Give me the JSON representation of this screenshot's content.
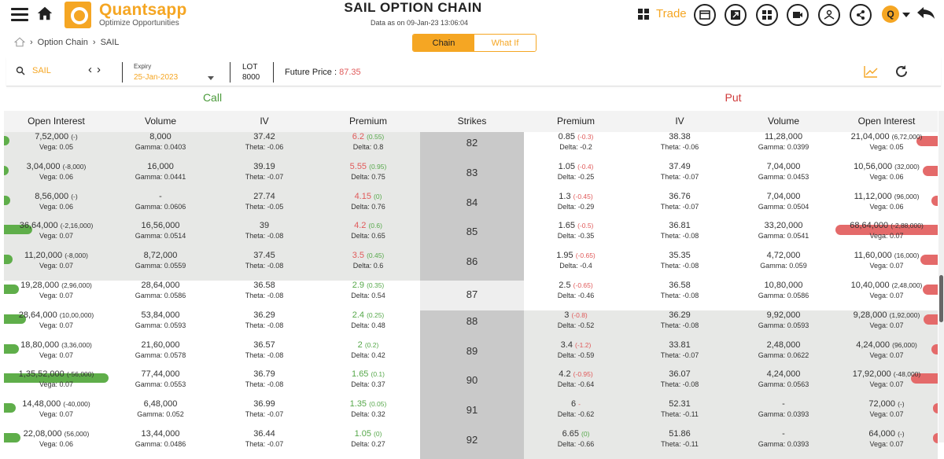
{
  "header": {
    "brand": "Quantsapp",
    "brand_tagline": "Optimize Opportunities",
    "title": "SAIL OPTION CHAIN",
    "as_of": "Data as on 09-Jan-23 13:06:04",
    "trade_label": "Trade",
    "avatar_initial": "Q"
  },
  "breadcrumb": {
    "item1": "Option Chain",
    "item2": "SAIL"
  },
  "tabs": {
    "chain": "Chain",
    "what_if": "What If",
    "active": "Chain"
  },
  "filters": {
    "symbol": "SAIL",
    "expiry_label": "Expiry",
    "expiry_value": "25-Jan-2023",
    "lot_label": "LOT",
    "lot_value": "8000",
    "future_label": "Future Price :",
    "future_value": "87.35"
  },
  "sections": {
    "call": "Call",
    "put": "Put"
  },
  "columns": [
    "Open Interest",
    "Volume",
    "IV",
    "Premium",
    "Strikes",
    "Premium",
    "IV",
    "Volume",
    "Open Interest"
  ],
  "colors": {
    "accent": "#f5a623",
    "call": "#4b9a3b",
    "put": "#cf3a3a",
    "call_bar": "#5fae4a",
    "put_bar": "#e46a6a"
  },
  "rows": [
    {
      "strike": "82",
      "c_oi": "7,52,000",
      "c_oi_chg": "(-)",
      "c_vega": "Vega: 0.05",
      "c_vol": "8,000",
      "c_gamma": "Gamma: 0.0403",
      "c_iv": "37.42",
      "c_theta": "Theta: -0.06",
      "c_prem": "6.2",
      "c_prem_chg": "(0.55)",
      "c_delta": "Delta: 0.8",
      "p_prem": "0.85",
      "p_prem_chg": "(-0.3)",
      "p_delta": "Delta: -0.2",
      "p_iv": "38.38",
      "p_theta": "Theta: -0.06",
      "p_vol": "11,28,000",
      "p_gamma": "Gamma: 0.0399",
      "p_oi": "21,04,000",
      "p_oi_chg": "(6,72,000)",
      "p_vega": "Vega: 0.05",
      "c_bar": 0.05,
      "p_bar": 0.21
    },
    {
      "strike": "83",
      "c_oi": "3,04,000",
      "c_oi_chg": "(-8,000)",
      "c_vega": "Vega: 0.06",
      "c_vol": "16,000",
      "c_gamma": "Gamma: 0.0441",
      "c_iv": "39.19",
      "c_theta": "Theta: -0.07",
      "c_prem": "5.55",
      "c_prem_chg": "(0.95)",
      "c_delta": "Delta: 0.75",
      "p_prem": "1.05",
      "p_prem_chg": "(-0.4)",
      "p_delta": "Delta: -0.25",
      "p_iv": "37.49",
      "p_theta": "Theta: -0.07",
      "p_vol": "7,04,000",
      "p_gamma": "Gamma: 0.0453",
      "p_oi": "10,56,000",
      "p_oi_chg": "(32,000)",
      "p_vega": "Vega: 0.06",
      "c_bar": 0.02,
      "p_bar": 0.15
    },
    {
      "strike": "84",
      "c_oi": "8,56,000",
      "c_oi_chg": "(-)",
      "c_vega": "Vega: 0.06",
      "c_vol": "-",
      "c_gamma": "Gamma: 0.0606",
      "c_iv": "27.74",
      "c_theta": "Theta: -0.05",
      "c_prem": "4.15",
      "c_prem_chg": "(0)",
      "c_delta": "Delta: 0.76",
      "p_prem": "1.3",
      "p_prem_chg": "(-0.45)",
      "p_delta": "Delta: -0.29",
      "p_iv": "36.76",
      "p_theta": "Theta: -0.07",
      "p_vol": "7,04,000",
      "p_gamma": "Gamma: 0.0504",
      "p_oi": "11,12,000",
      "p_oi_chg": "(96,000)",
      "p_vega": "Vega: 0.06",
      "c_bar": 0.06,
      "p_bar": 0.06
    },
    {
      "strike": "85",
      "c_oi": "36,64,000",
      "c_oi_chg": "(-2,16,000)",
      "c_vega": "Vega: 0.07",
      "c_vol": "16,56,000",
      "c_gamma": "Gamma: 0.0514",
      "c_iv": "39",
      "c_theta": "Theta: -0.08",
      "c_prem": "4.2",
      "c_prem_chg": "(0.6)",
      "c_delta": "Delta: 0.65",
      "p_prem": "1.65",
      "p_prem_chg": "(-0.5)",
      "p_delta": "Delta: -0.35",
      "p_iv": "36.81",
      "p_theta": "Theta: -0.08",
      "p_vol": "33,20,000",
      "p_gamma": "Gamma: 0.0541",
      "p_oi": "68,64,000",
      "p_oi_chg": "(-2,88,000)",
      "p_vega": "Vega: 0.07",
      "c_bar": 0.27,
      "p_bar": 1.0
    },
    {
      "strike": "86",
      "c_oi": "11,20,000",
      "c_oi_chg": "(-8,000)",
      "c_vega": "Vega: 0.07",
      "c_vol": "8,72,000",
      "c_gamma": "Gamma: 0.0559",
      "c_iv": "37.45",
      "c_theta": "Theta: -0.08",
      "c_prem": "3.5",
      "c_prem_chg": "(0.45)",
      "c_delta": "Delta: 0.6",
      "p_prem": "1.95",
      "p_prem_chg": "(-0.65)",
      "p_delta": "Delta: -0.4",
      "p_iv": "35.35",
      "p_theta": "Theta: -0.08",
      "p_vol": "4,72,000",
      "p_gamma": "Gamma: 0.059",
      "p_oi": "11,60,000",
      "p_oi_chg": "(16,000)",
      "p_vega": "Vega: 0.07",
      "c_bar": 0.08,
      "p_bar": 0.17
    },
    {
      "strike": "87",
      "c_oi": "19,28,000",
      "c_oi_chg": "(2,96,000)",
      "c_vega": "Vega: 0.07",
      "c_vol": "28,64,000",
      "c_gamma": "Gamma: 0.0586",
      "c_iv": "36.58",
      "c_theta": "Theta: -0.08",
      "c_prem": "2.9",
      "c_prem_chg": "(0.35)",
      "c_delta": "Delta: 0.54",
      "p_prem": "2.5",
      "p_prem_chg": "(-0.65)",
      "p_delta": "Delta: -0.46",
      "p_iv": "36.58",
      "p_theta": "Theta: -0.08",
      "p_vol": "10,80,000",
      "p_gamma": "Gamma: 0.0586",
      "p_oi": "10,40,000",
      "p_oi_chg": "(2,48,000)",
      "p_vega": "Vega: 0.07",
      "c_bar": 0.14,
      "p_bar": 0.15
    },
    {
      "strike": "88",
      "c_oi": "28,64,000",
      "c_oi_chg": "(10,00,000)",
      "c_vega": "Vega: 0.07",
      "c_vol": "53,84,000",
      "c_gamma": "Gamma: 0.0593",
      "c_iv": "36.29",
      "c_theta": "Theta: -0.08",
      "c_prem": "2.4",
      "c_prem_chg": "(0.25)",
      "c_delta": "Delta: 0.48",
      "p_prem": "3",
      "p_prem_chg": "(-0.8)",
      "p_delta": "Delta: -0.52",
      "p_iv": "36.29",
      "p_theta": "Theta: -0.08",
      "p_vol": "9,92,000",
      "p_gamma": "Gamma: 0.0593",
      "p_oi": "9,28,000",
      "p_oi_chg": "(1,92,000)",
      "p_vega": "Vega: 0.07",
      "c_bar": 0.21,
      "p_bar": 0.14
    },
    {
      "strike": "89",
      "c_oi": "18,80,000",
      "c_oi_chg": "(3,36,000)",
      "c_vega": "Vega: 0.07",
      "c_vol": "21,60,000",
      "c_gamma": "Gamma: 0.0578",
      "c_iv": "36.57",
      "c_theta": "Theta: -0.08",
      "c_prem": "2",
      "c_prem_chg": "(0.2)",
      "c_delta": "Delta: 0.42",
      "p_prem": "3.4",
      "p_prem_chg": "(-1.2)",
      "p_delta": "Delta: -0.59",
      "p_iv": "33.81",
      "p_theta": "Theta: -0.07",
      "p_vol": "2,48,000",
      "p_gamma": "Gamma: 0.0622",
      "p_oi": "4,24,000",
      "p_oi_chg": "(96,000)",
      "p_vega": "Vega: 0.07",
      "c_bar": 0.14,
      "p_bar": 0.06
    },
    {
      "strike": "90",
      "c_oi": "1,35,52,000",
      "c_oi_chg": "(-56,000)",
      "c_vega": "Vega: 0.07",
      "c_vol": "77,44,000",
      "c_gamma": "Gamma: 0.0553",
      "c_iv": "36.79",
      "c_theta": "Theta: -0.08",
      "c_prem": "1.65",
      "c_prem_chg": "(0.1)",
      "c_delta": "Delta: 0.37",
      "p_prem": "4.2",
      "p_prem_chg": "(-0.95)",
      "p_delta": "Delta: -0.64",
      "p_iv": "36.07",
      "p_theta": "Theta: -0.08",
      "p_vol": "4,24,000",
      "p_gamma": "Gamma: 0.0563",
      "p_oi": "17,92,000",
      "p_oi_chg": "(-48,000)",
      "p_vega": "Vega: 0.07",
      "c_bar": 1.0,
      "p_bar": 0.26
    },
    {
      "strike": "91",
      "c_oi": "14,48,000",
      "c_oi_chg": "(-40,000)",
      "c_vega": "Vega: 0.07",
      "c_vol": "6,48,000",
      "c_gamma": "Gamma: 0.052",
      "c_iv": "36.99",
      "c_theta": "Theta: -0.07",
      "c_prem": "1.35",
      "c_prem_chg": "(0.05)",
      "c_delta": "Delta: 0.32",
      "p_prem": "6",
      "p_prem_chg": "-",
      "p_delta": "Delta: -0.62",
      "p_iv": "52.31",
      "p_theta": "Theta: -0.11",
      "p_vol": "-",
      "p_gamma": "Gamma: 0.0393",
      "p_oi": "72,000",
      "p_oi_chg": "(-)",
      "p_vega": "Vega: 0.07",
      "c_bar": 0.11,
      "p_bar": 0.01
    },
    {
      "strike": "92",
      "c_oi": "22,08,000",
      "c_oi_chg": "(56,000)",
      "c_vega": "Vega: 0.06",
      "c_vol": "13,44,000",
      "c_gamma": "Gamma: 0.0486",
      "c_iv": "36.44",
      "c_theta": "Theta: -0.07",
      "c_prem": "1.05",
      "c_prem_chg": "(0)",
      "c_delta": "Delta: 0.27",
      "p_prem": "6.65",
      "p_prem_chg": "(0)",
      "p_delta": "Delta: -0.66",
      "p_iv": "51.86",
      "p_theta": "Theta: -0.11",
      "p_vol": "-",
      "p_gamma": "Gamma: 0.0393",
      "p_oi": "64,000",
      "p_oi_chg": "(-)",
      "p_vega": "Vega: 0.07",
      "c_bar": 0.16,
      "p_bar": 0.01
    }
  ]
}
